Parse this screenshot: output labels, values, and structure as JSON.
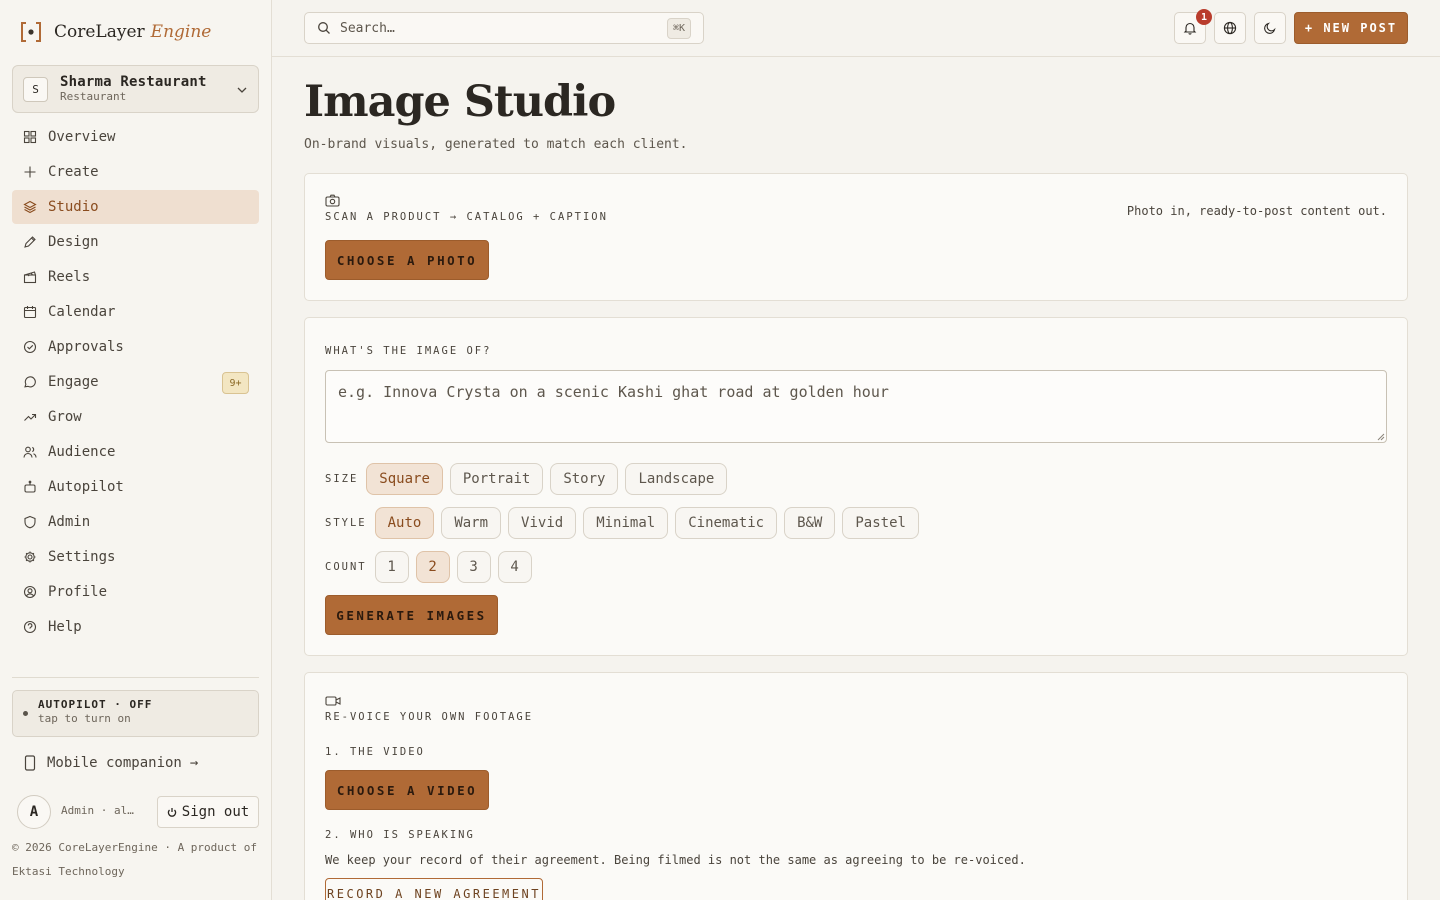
{
  "brand": {
    "name": "CoreLayer",
    "suffix": "Engine"
  },
  "org": {
    "initial": "S",
    "name": "Sharma Restaurant",
    "type": "Restaurant"
  },
  "nav": [
    {
      "label": "Overview",
      "icon": "grid-icon"
    },
    {
      "label": "Create",
      "icon": "plus-icon"
    },
    {
      "label": "Studio",
      "icon": "layers-icon",
      "active": true
    },
    {
      "label": "Design",
      "icon": "pen-icon"
    },
    {
      "label": "Reels",
      "icon": "clapper-icon"
    },
    {
      "label": "Calendar",
      "icon": "calendar-icon"
    },
    {
      "label": "Approvals",
      "icon": "check-circle-icon"
    },
    {
      "label": "Engage",
      "icon": "chat-icon",
      "badge": "9+"
    },
    {
      "label": "Grow",
      "icon": "trend-icon"
    },
    {
      "label": "Audience",
      "icon": "users-icon"
    },
    {
      "label": "Autopilot",
      "icon": "bot-icon"
    },
    {
      "label": "Admin",
      "icon": "shield-icon"
    },
    {
      "label": "Settings",
      "icon": "gear-icon"
    },
    {
      "label": "Profile",
      "icon": "user-circle-icon"
    },
    {
      "label": "Help",
      "icon": "help-icon"
    }
  ],
  "autopilot": {
    "title": "AUTOPILOT · OFF",
    "hint": "tap to turn on"
  },
  "mobile": {
    "label": "Mobile companion"
  },
  "user": {
    "initial": "A",
    "email": "Admin · al…",
    "signout": "Sign out"
  },
  "footer": {
    "copy": "© 2026 CoreLayerEngine · A product of Ektasi Technology"
  },
  "topbar": {
    "search_placeholder": "Search…",
    "shortcut": "⌘K",
    "notif_count": "1",
    "new_post": "+ NEW POST"
  },
  "page": {
    "title": "Image Studio",
    "subtitle": "On-brand visuals, generated to match each client."
  },
  "scan": {
    "eyebrow": "SCAN A PRODUCT → CATALOG + CAPTION",
    "button": "CHOOSE A PHOTO",
    "tagline": "Photo in, ready-to-post content out."
  },
  "generate": {
    "eyebrow": "WHAT'S THE IMAGE OF?",
    "placeholder": "e.g. Innova Crysta on a scenic Kashi ghat road at golden hour",
    "size_label": "SIZE",
    "sizes": [
      "Square",
      "Portrait",
      "Story",
      "Landscape"
    ],
    "size_selected": "Square",
    "style_label": "STYLE",
    "styles": [
      "Auto",
      "Warm",
      "Vivid",
      "Minimal",
      "Cinematic",
      "B&W",
      "Pastel"
    ],
    "style_selected": "Auto",
    "count_label": "COUNT",
    "counts": [
      "1",
      "2",
      "3",
      "4"
    ],
    "count_selected": "2",
    "button": "GENERATE IMAGES"
  },
  "revoice": {
    "eyebrow": "RE-VOICE YOUR OWN FOOTAGE",
    "step1": "1. THE VIDEO",
    "video_button": "CHOOSE A VIDEO",
    "step2": "2. WHO IS SPEAKING",
    "consent_note": "We keep your record of their agreement. Being filmed is not the same as agreeing to be re-voiced.",
    "agreement_button": "RECORD A NEW AGREEMENT"
  },
  "colors": {
    "accent": "#b06a36",
    "active_bg": "#efdfd0",
    "badge": "#b93c2c"
  }
}
